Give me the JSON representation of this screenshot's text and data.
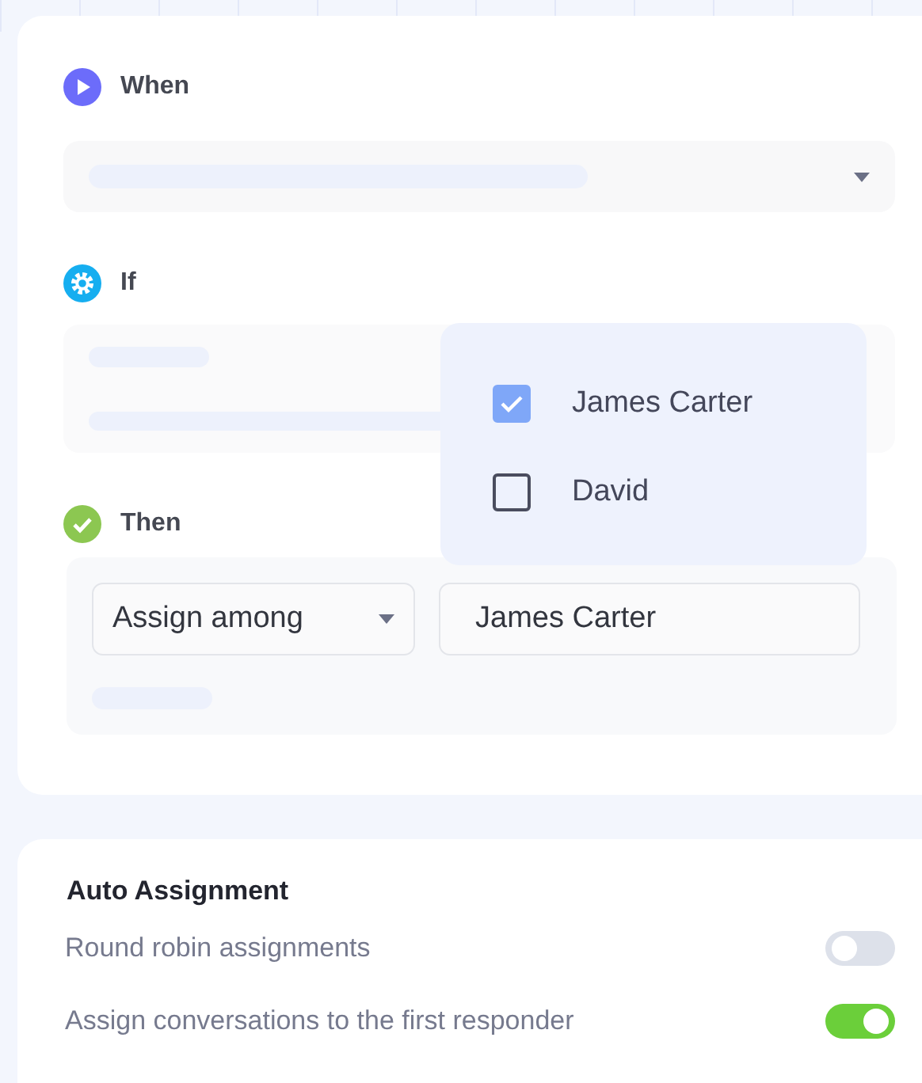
{
  "rule": {
    "sections": [
      {
        "kind": "when",
        "label": "When"
      },
      {
        "kind": "if",
        "label": "If"
      },
      {
        "kind": "then",
        "label": "Then",
        "action": {
          "select": "Assign among",
          "value": "James Carter"
        }
      }
    ],
    "popup": {
      "options": [
        {
          "label": "James Carter",
          "checked": true
        },
        {
          "label": "David",
          "checked": false
        }
      ]
    }
  },
  "auto_assignment": {
    "title": "Auto Assignment",
    "settings": [
      {
        "label": "Round robin assignments",
        "on": false
      },
      {
        "label": "Assign conversations to the first responder",
        "on": true
      }
    ]
  }
}
